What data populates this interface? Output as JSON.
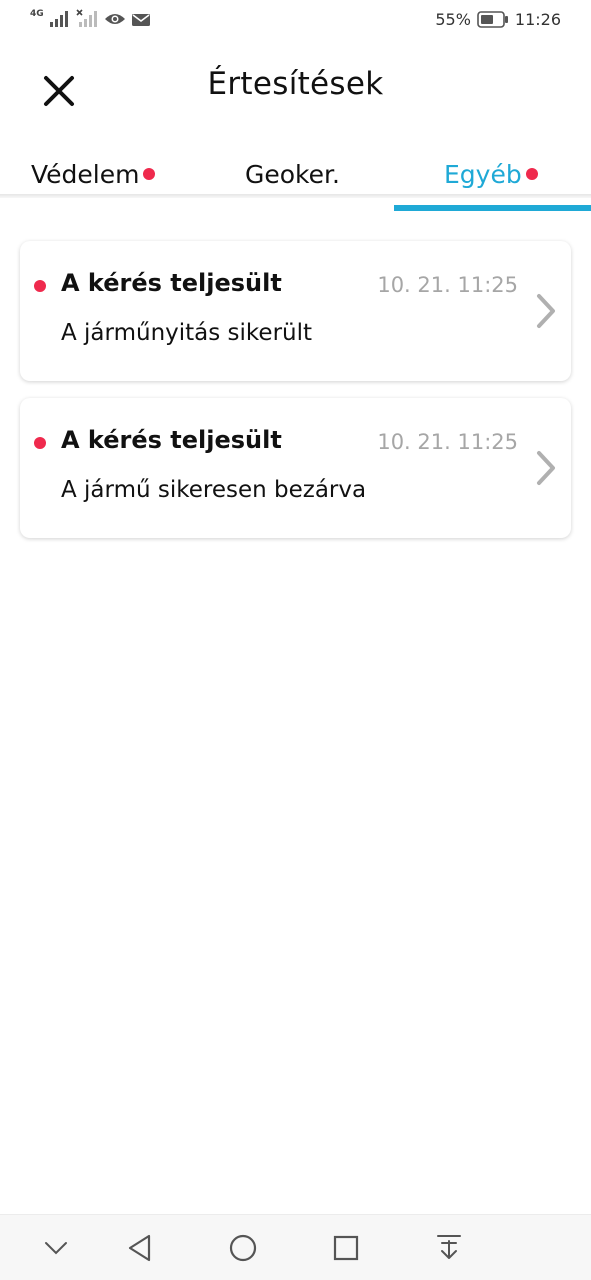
{
  "status_bar": {
    "network": "4G",
    "battery": "55%",
    "time": "11:26"
  },
  "header": {
    "title": "Értesítések"
  },
  "tabs": [
    {
      "label": "Védelem",
      "unread": true
    },
    {
      "label": "Geoker.",
      "unread": false
    },
    {
      "label": "Egyéb",
      "unread": true,
      "active": true
    }
  ],
  "notifications": [
    {
      "title": "A kérés teljesült",
      "time": "10. 21. 11:25",
      "message": "A járműnyitás sikerült",
      "unread": true
    },
    {
      "title": "A kérés teljesült",
      "time": "10. 21. 11:25",
      "message": "A jármű sikeresen bezárva",
      "unread": true
    }
  ],
  "colors": {
    "accent": "#1fa9d6",
    "unread_dot": "#ef2a4d",
    "timestamp": "#a6a6a6"
  },
  "icons": [
    "close-icon",
    "chevron-right-icon",
    "nav-collapse-icon",
    "nav-back-icon",
    "nav-home-icon",
    "nav-recents-icon",
    "nav-notifications-icon"
  ]
}
